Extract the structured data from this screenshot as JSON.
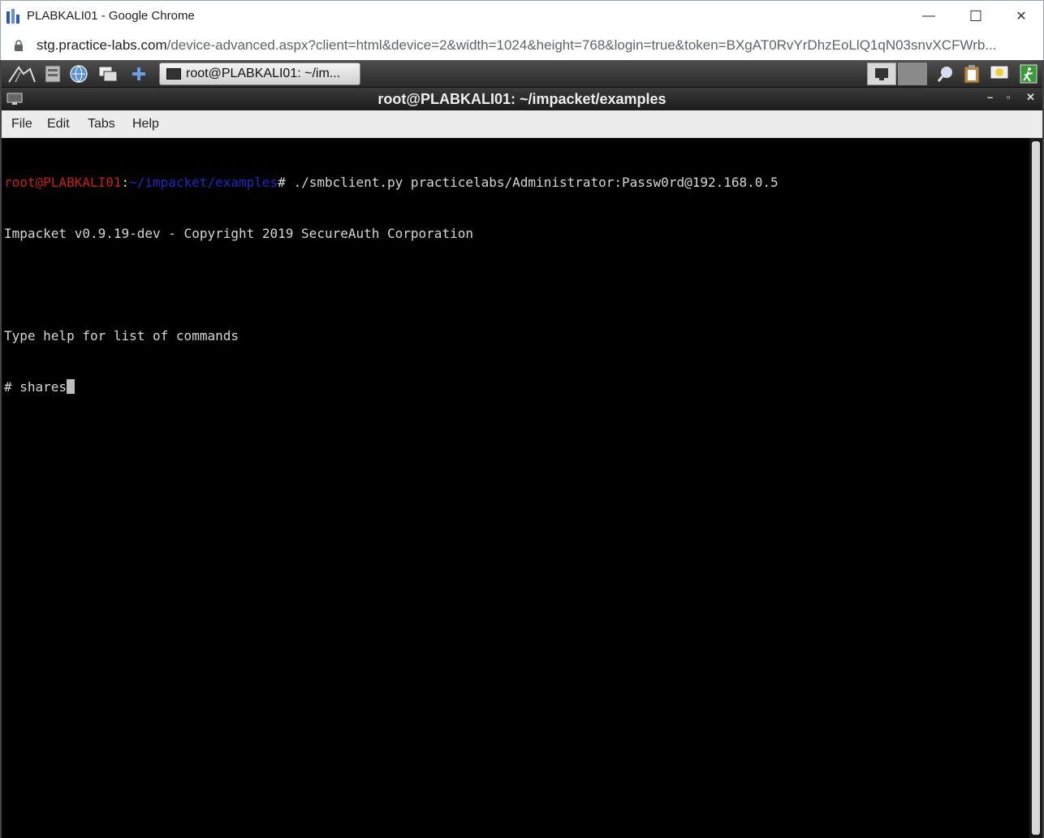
{
  "browser": {
    "window_title": "PLABKALI01 - Google Chrome",
    "url_host": "stg.practice-labs.com",
    "url_rest": "/device-advanced.aspx?client=html&device=2&width=1024&height=768&login=true&token=BXgAT0RvYrDhzEoLlQ1qN03snvXCFWrb...",
    "minimize_glyph": "—",
    "maximize_glyph": "☐",
    "close_glyph": "✕"
  },
  "panel": {
    "taskbar_item": "root@PLABKALI01: ~/im..."
  },
  "terminal": {
    "title": "root@PLABKALI01: ~/impacket/examples",
    "menu": [
      "File",
      "Edit",
      "Tabs",
      "Help"
    ],
    "prompt_user": "root@PLABKALI01",
    "prompt_sep": ":",
    "prompt_path": "~/impacket/examples",
    "prompt_end": "# ",
    "command": "./smbclient.py practicelabs/Administrator:Passw0rd@192.168.0.5",
    "output": [
      "Impacket v0.9.19-dev - Copyright 2019 SecureAuth Corporation",
      "",
      "Type help for list of commands"
    ],
    "current_input": "# shares"
  }
}
